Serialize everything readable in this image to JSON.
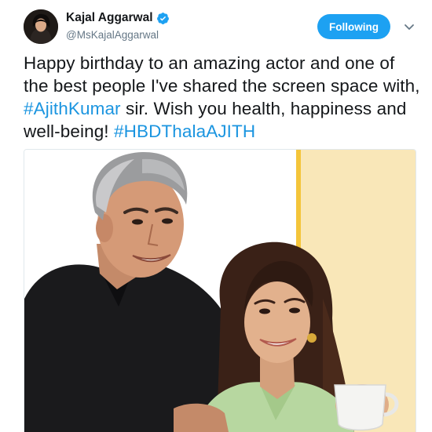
{
  "user": {
    "display_name": "Kajal Aggarwal",
    "handle": "@MsKajalAggarwal",
    "verified_icon": "verified-badge-icon"
  },
  "follow_button": {
    "label": "Following"
  },
  "caret_icon": "chevron-down-icon",
  "tweet": {
    "text_1": "Happy birthday to an amazing actor and one of the best people I've shared the screen space with, ",
    "hashtag_1": "#AjithKumar",
    "text_2": " sir. Wish you health, happiness and well-being! ",
    "hashtag_2": "#HBDThalaAJITH"
  },
  "colors": {
    "accent": "#1da1f2",
    "hashtag": "#1b95e0",
    "handle": "#657786",
    "text": "#14171a"
  }
}
